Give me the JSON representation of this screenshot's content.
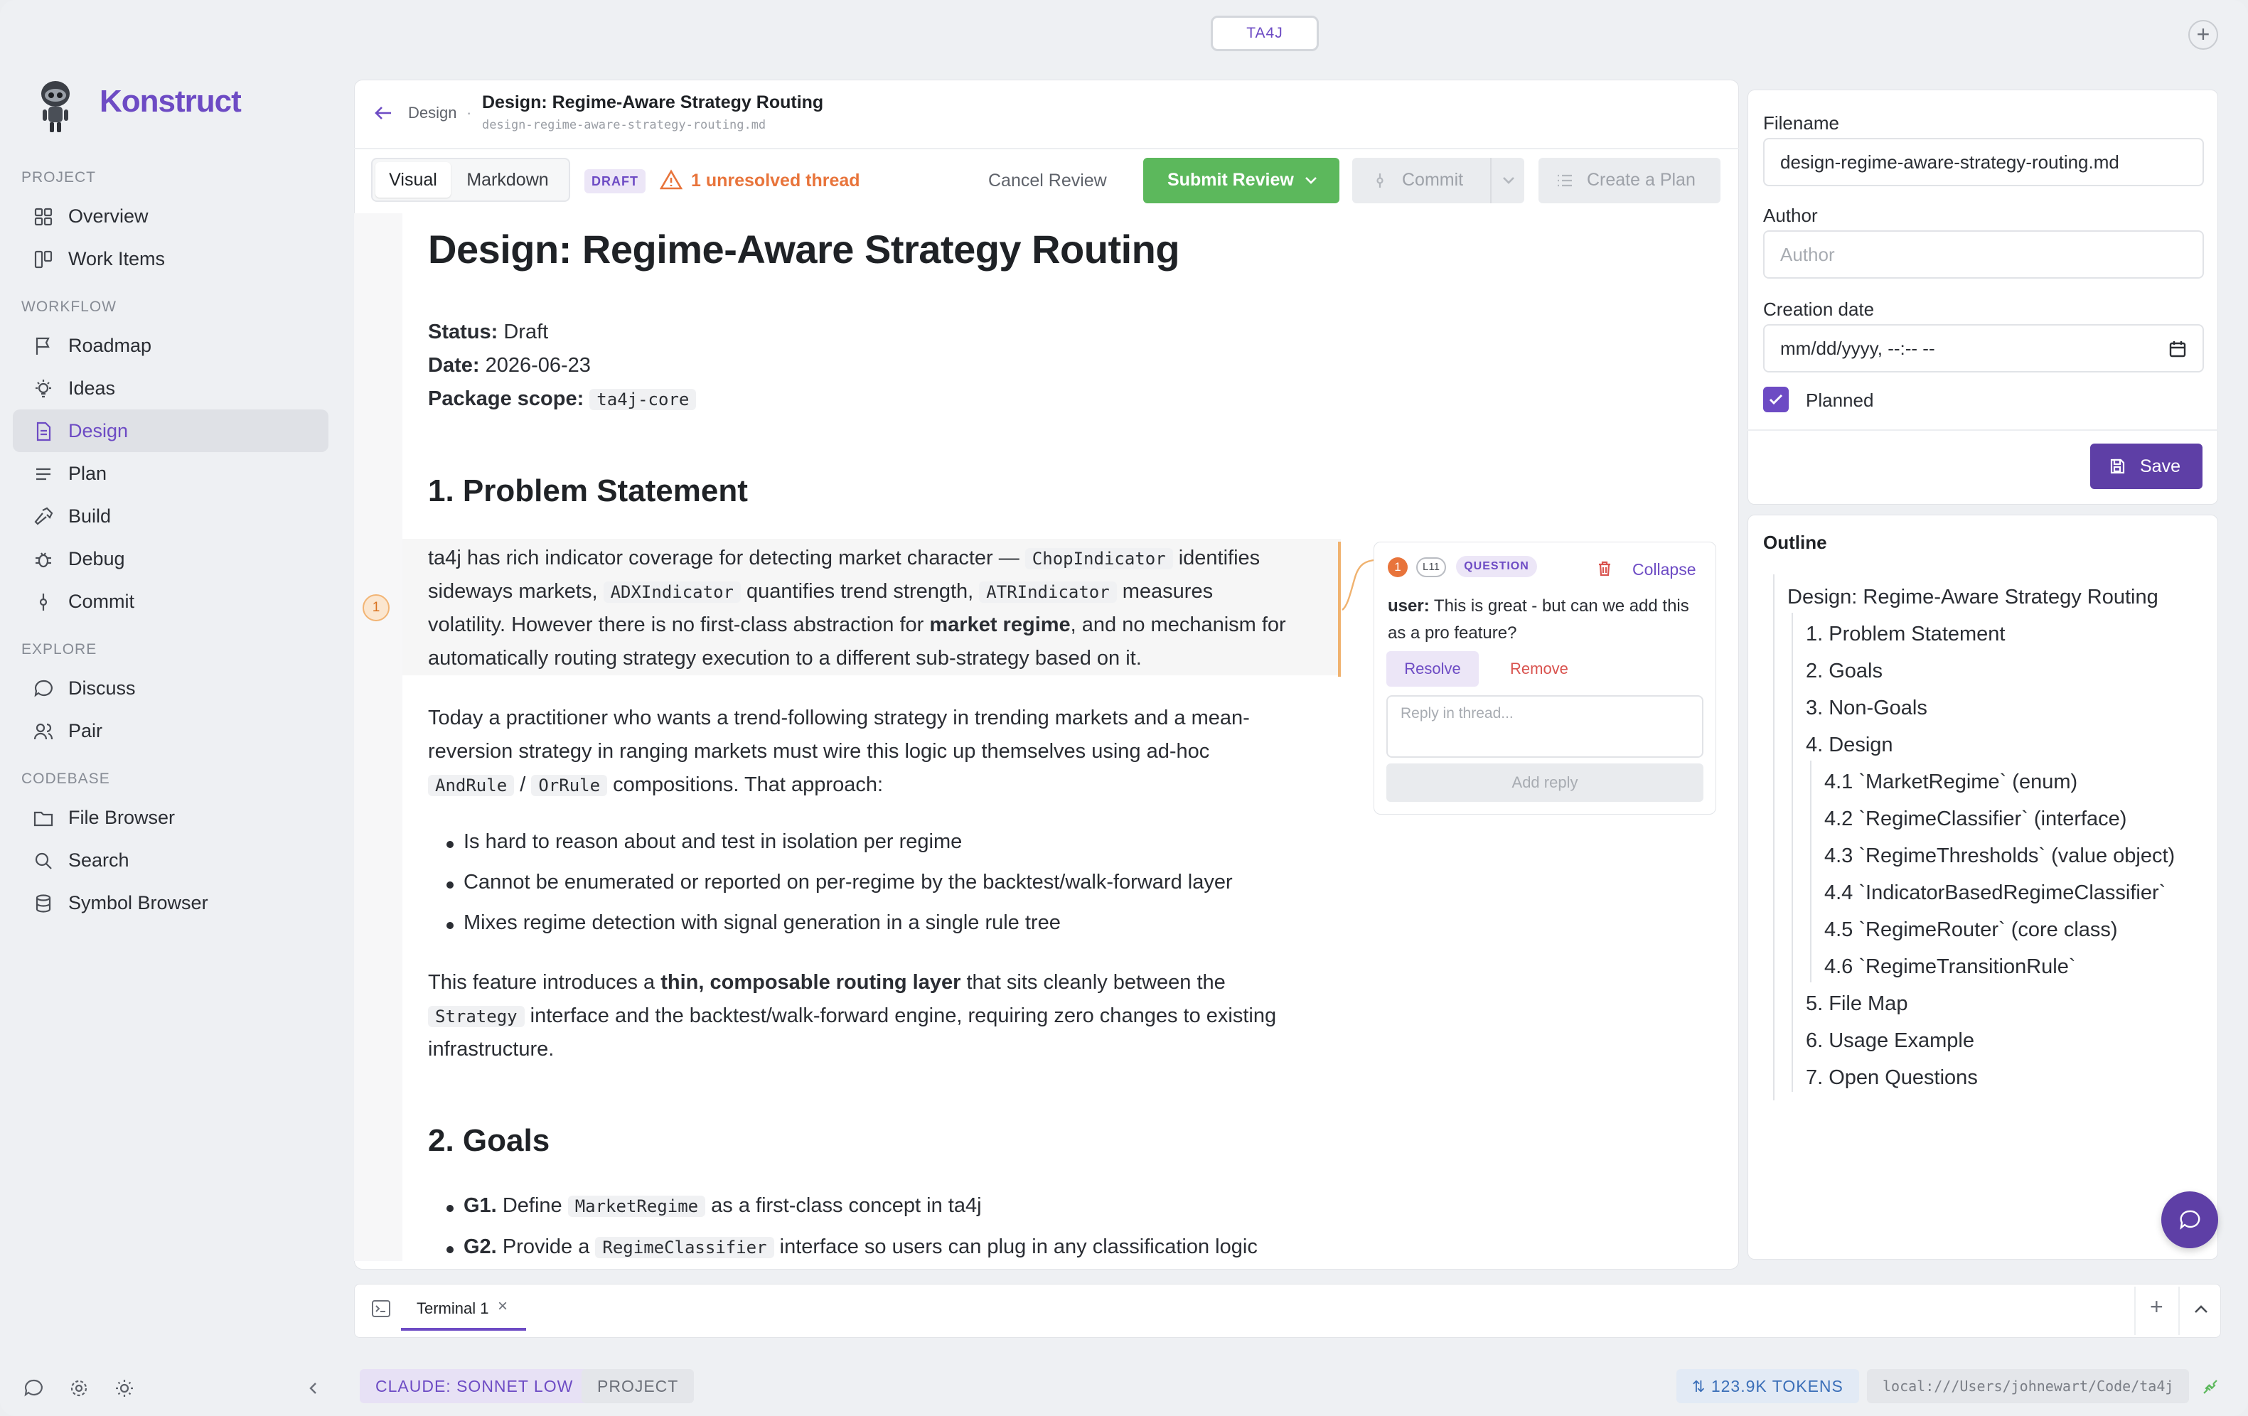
{
  "app": {
    "brand": "Konstruct",
    "workspace_tab": "TA4J"
  },
  "sidebar": {
    "sections": {
      "project": "PROJECT",
      "workflow": "WORKFLOW",
      "explore": "EXPLORE",
      "codebase": "CODEBASE"
    },
    "items": [
      {
        "label": "Overview",
        "icon": "grid-icon"
      },
      {
        "label": "Work Items",
        "icon": "kanban-icon"
      },
      {
        "label": "Roadmap",
        "icon": "flag-icon"
      },
      {
        "label": "Ideas",
        "icon": "lightbulb-icon"
      },
      {
        "label": "Design",
        "icon": "document-icon",
        "active": true
      },
      {
        "label": "Plan",
        "icon": "list-icon"
      },
      {
        "label": "Build",
        "icon": "hammer-icon"
      },
      {
        "label": "Debug",
        "icon": "bug-icon"
      },
      {
        "label": "Commit",
        "icon": "commit-icon"
      },
      {
        "label": "Discuss",
        "icon": "chat-icon"
      },
      {
        "label": "Pair",
        "icon": "users-icon"
      },
      {
        "label": "File Browser",
        "icon": "folder-icon"
      },
      {
        "label": "Search",
        "icon": "search-icon"
      },
      {
        "label": "Symbol Browser",
        "icon": "database-icon"
      }
    ]
  },
  "doc": {
    "breadcrumb_parent": "Design",
    "breadcrumb_sep": "·",
    "title": "Design: Regime-Aware Strategy Routing",
    "filename_sub": "design-regime-aware-strategy-routing.md",
    "view_tabs": [
      "Visual",
      "Markdown"
    ],
    "draft_badge": "DRAFT",
    "unresolved": "1 unresolved thread",
    "cancel_review": "Cancel Review",
    "submit_review": "Submit Review",
    "commit": "Commit",
    "create_plan": "Create a Plan",
    "h1": "Design: Regime-Aware Strategy Routing",
    "status_label": "Status:",
    "status_value": "Draft",
    "date_label": "Date:",
    "date_value": "2026-06-23",
    "scope_label": "Package scope:",
    "scope_value": "ta4j-core",
    "h2_problem": "1. Problem Statement",
    "p1": {
      "a": "ta4j has rich indicator coverage for detecting market character —",
      "code1": "ChopIndicator",
      "b": "identifies",
      "c": "sideways markets,",
      "code2": "ADXIndicator",
      "d": "quantifies trend strength,",
      "code3": "ATRIndicator",
      "e": "measures",
      "f": "volatility. However there is no first-class abstraction for",
      "bold": "market regime",
      "g": ", and no mechanism for",
      "h": "automatically routing strategy execution to a different sub-strategy based on it."
    },
    "p2": {
      "a": "Today a practitioner who wants a trend-following strategy in trending markets and a mean-",
      "b": "reversion strategy in ranging markets must wire this logic up themselves using ad-hoc",
      "code1": "AndRule",
      "slash": "/",
      "code2": "OrRule",
      "c": "compositions. That approach:"
    },
    "bullets": [
      "Is hard to reason about and test in isolation per regime",
      "Cannot be enumerated or reported on per-regime by the backtest/walk-forward layer",
      "Mixes regime detection with signal generation in a single rule tree"
    ],
    "p3": {
      "a": "This feature introduces a",
      "bold": "thin, composable routing layer",
      "b": "that sits cleanly between the",
      "code1": "Strategy",
      "c": "interface and the backtest/walk-forward engine, requiring zero changes to existing",
      "d": "infrastructure."
    },
    "h2_goals": "2. Goals",
    "goals": [
      {
        "label": "G1.",
        "a": "Define",
        "code": "MarketRegime",
        "b": "as a first-class concept in ta4j"
      },
      {
        "label": "G2.",
        "a": "Provide a",
        "code": "RegimeClassifier",
        "b": "interface so users can plug in any classification logic"
      }
    ],
    "gutter_marker": "1"
  },
  "comment": {
    "count": "1",
    "line": "L11",
    "type": "QUESTION",
    "collapse": "Collapse",
    "author": "user:",
    "text_line1": "This is great - but can we add this",
    "text_line2": "as a pro feature?",
    "resolve": "Resolve",
    "remove": "Remove",
    "reply_placeholder": "Reply in thread...",
    "add_reply": "Add reply"
  },
  "meta": {
    "filename_label": "Filename",
    "filename_value": "design-regime-aware-strategy-routing.md",
    "author_label": "Author",
    "author_placeholder": "Author",
    "date_label": "Creation date",
    "date_value": "mm/dd/yyyy, --:-- --",
    "planned_label": "Planned",
    "planned_checked": true,
    "save": "Save"
  },
  "outline": {
    "title": "Outline",
    "items": [
      {
        "label": "Design: Regime-Aware Strategy Routing",
        "level": 0
      },
      {
        "label": "1. Problem Statement",
        "level": 1
      },
      {
        "label": "2. Goals",
        "level": 1
      },
      {
        "label": "3. Non-Goals",
        "level": 1
      },
      {
        "label": "4. Design",
        "level": 1
      },
      {
        "label": "4.1 `MarketRegime` (enum)",
        "level": 2
      },
      {
        "label": "4.2 `RegimeClassifier` (interface)",
        "level": 2
      },
      {
        "label": "4.3 `RegimeThresholds` (value object)",
        "level": 2
      },
      {
        "label": "4.4 `IndicatorBasedRegimeClassifier`",
        "level": 2
      },
      {
        "label": "4.5 `RegimeRouter` (core class)",
        "level": 2
      },
      {
        "label": "4.6 `RegimeTransitionRule`",
        "level": 2
      },
      {
        "label": "5. File Map",
        "level": 1
      },
      {
        "label": "6. Usage Example",
        "level": 1
      },
      {
        "label": "7. Open Questions",
        "level": 1
      }
    ]
  },
  "terminal": {
    "tab": "Terminal 1",
    "close": "×",
    "add": "+"
  },
  "statusbar": {
    "model": "CLAUDE: SONNET LOW",
    "scope": "PROJECT",
    "tokens": "123.9K TOKENS",
    "path": "local:///Users/johnewart/Code/ta4j"
  },
  "colors": {
    "accent": "#6d4bc4",
    "green": "#5cb85c",
    "warning": "#e8743b",
    "danger": "#d9534f"
  }
}
